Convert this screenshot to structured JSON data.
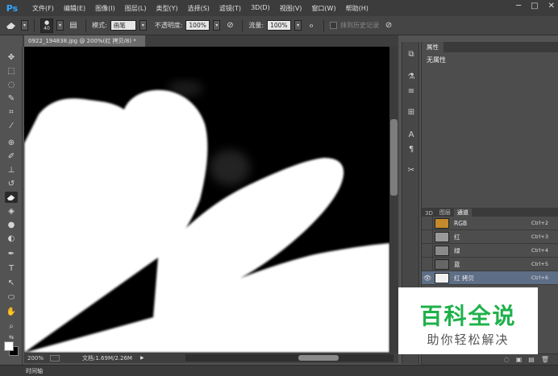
{
  "app": {
    "logo": "Ps"
  },
  "menu": [
    "文件(F)",
    "编辑(E)",
    "图像(I)",
    "图层(L)",
    "类型(Y)",
    "选择(S)",
    "滤镜(T)",
    "3D(D)",
    "视图(V)",
    "窗口(W)",
    "帮助(H)"
  ],
  "window_controls": [
    "─",
    "□",
    "✕"
  ],
  "options": {
    "brush_size": "40",
    "mode_label": "模式:",
    "mode_value": "画笔",
    "opacity_label": "不透明度:",
    "opacity_value": "100%",
    "flow_label": "流量:",
    "flow_value": "100%",
    "erase_history_label": "抹到历史记录"
  },
  "document": {
    "tab_title": "0922_194838.jpg @ 200%(红 拷贝/8) *",
    "zoom": "200%",
    "doc_info": "文档:1.69M/2.26M"
  },
  "timeline": {
    "label": "时间轴"
  },
  "properties": {
    "tab": "属性",
    "body": "无属性"
  },
  "channels": {
    "tabs": [
      "3D",
      "图层",
      "通道"
    ],
    "active_tab": 2,
    "rows": [
      {
        "name": "RGB",
        "shortcut": "Ctrl+2",
        "visible": false,
        "selected": false,
        "thumb": "#c58a2c"
      },
      {
        "name": "红",
        "shortcut": "Ctrl+3",
        "visible": false,
        "selected": false,
        "thumb": "#9a9a9a"
      },
      {
        "name": "绿",
        "shortcut": "Ctrl+4",
        "visible": false,
        "selected": false,
        "thumb": "#8a8a8a"
      },
      {
        "name": "蓝",
        "shortcut": "Ctrl+5",
        "visible": false,
        "selected": false,
        "thumb": "#666666"
      },
      {
        "name": "红 拷贝",
        "shortcut": "Ctrl+6",
        "visible": true,
        "selected": true,
        "thumb": "#f0f0f0"
      }
    ]
  },
  "watermark": {
    "title": "百科全说",
    "subtitle": "助你轻松解决",
    "title_color": "#1fb14b"
  }
}
